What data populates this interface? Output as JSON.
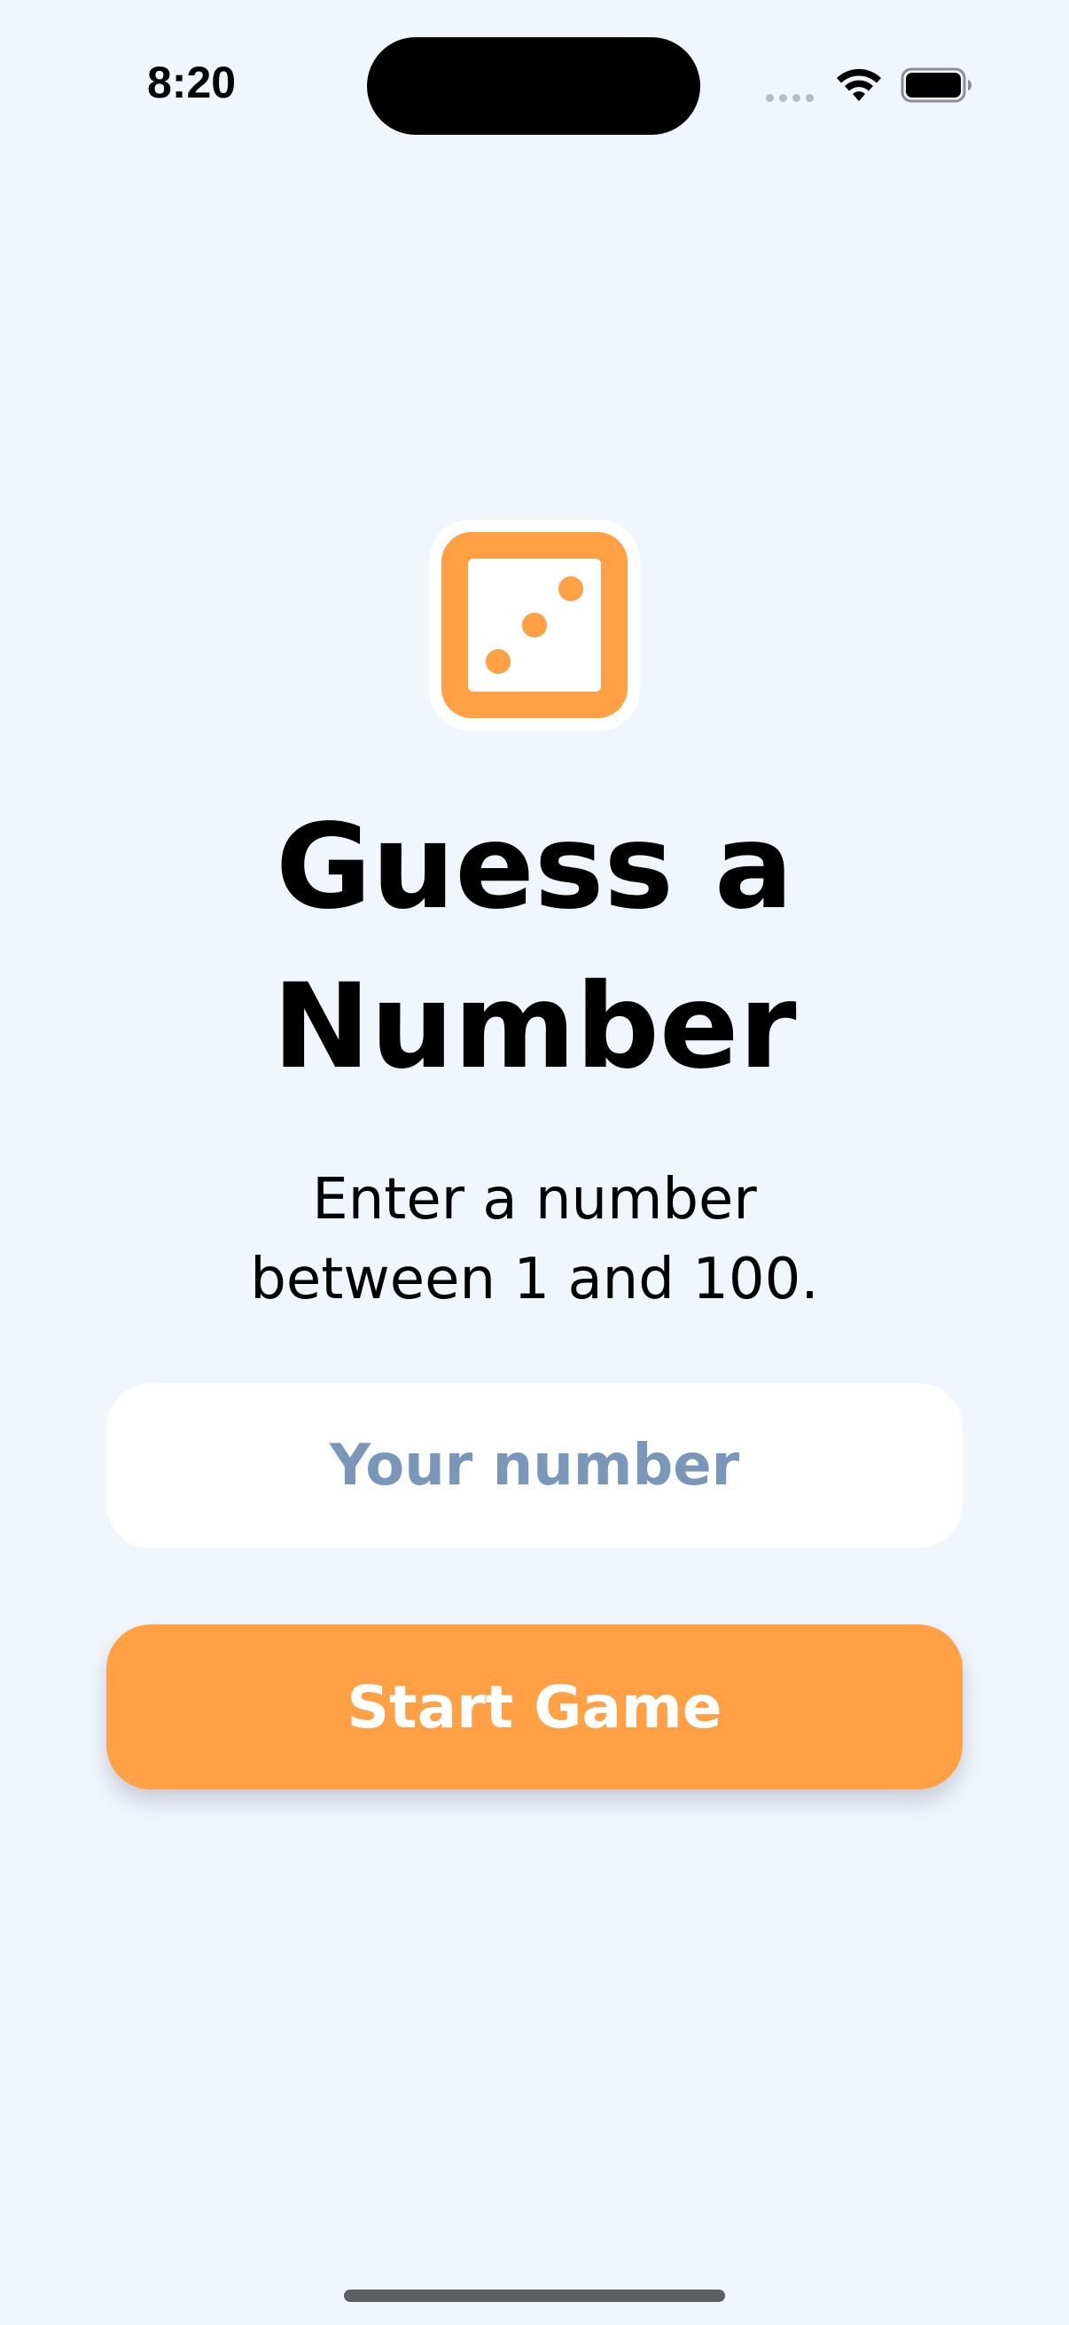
{
  "status_bar": {
    "time": "8:20",
    "icons": [
      "signal-dots-icon",
      "wifi-icon",
      "battery-icon"
    ]
  },
  "logo": {
    "icon": "dice-icon",
    "accent_color": "#ffa045"
  },
  "title": {
    "line1": "Guess a",
    "line2": "Number"
  },
  "subtitle": {
    "line1": "Enter a number",
    "line2": "between 1 and 100."
  },
  "number_input": {
    "value": "",
    "placeholder": "Your number"
  },
  "start_button": {
    "label": "Start Game",
    "color": "#ffa045"
  },
  "colors": {
    "background": "#f1f6fd",
    "placeholder": "#7a96b8",
    "surface": "#ffffff"
  }
}
